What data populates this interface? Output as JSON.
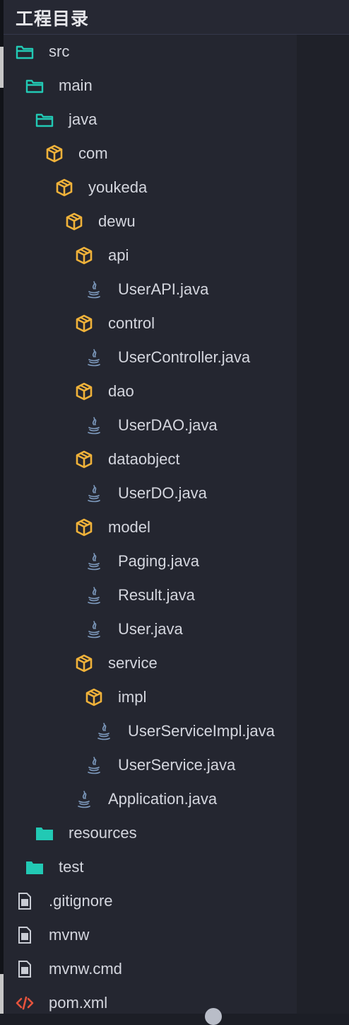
{
  "header": {
    "title": "工程目录"
  },
  "colors": {
    "folder": "#22c9b4",
    "package": "#f0b23a",
    "java": "#7f9cc0",
    "file": "#c9ccd4",
    "xml": "#e5533d"
  },
  "tree": [
    {
      "label": "src",
      "icon": "folder-open-icon",
      "depth": 0
    },
    {
      "label": "main",
      "icon": "folder-open-icon",
      "depth": 1
    },
    {
      "label": "java",
      "icon": "folder-open-icon",
      "depth": 2
    },
    {
      "label": "com",
      "icon": "package-icon",
      "depth": 3
    },
    {
      "label": "youkeda",
      "icon": "package-icon",
      "depth": 4
    },
    {
      "label": "dewu",
      "icon": "package-icon",
      "depth": 5
    },
    {
      "label": "api",
      "icon": "package-icon",
      "depth": 6
    },
    {
      "label": "UserAPI.java",
      "icon": "java-file-icon",
      "depth": 7
    },
    {
      "label": "control",
      "icon": "package-icon",
      "depth": 6
    },
    {
      "label": "UserController.java",
      "icon": "java-file-icon",
      "depth": 7
    },
    {
      "label": "dao",
      "icon": "package-icon",
      "depth": 6
    },
    {
      "label": "UserDAO.java",
      "icon": "java-file-icon",
      "depth": 7
    },
    {
      "label": "dataobject",
      "icon": "package-icon",
      "depth": 6
    },
    {
      "label": "UserDO.java",
      "icon": "java-file-icon",
      "depth": 7
    },
    {
      "label": "model",
      "icon": "package-icon",
      "depth": 6
    },
    {
      "label": "Paging.java",
      "icon": "java-file-icon",
      "depth": 7
    },
    {
      "label": "Result.java",
      "icon": "java-file-icon",
      "depth": 7
    },
    {
      "label": "User.java",
      "icon": "java-file-icon",
      "depth": 7
    },
    {
      "label": "service",
      "icon": "package-icon",
      "depth": 6
    },
    {
      "label": "impl",
      "icon": "package-icon",
      "depth": 7
    },
    {
      "label": "UserServiceImpl.java",
      "icon": "java-file-icon",
      "depth": 8
    },
    {
      "label": "UserService.java",
      "icon": "java-file-icon",
      "depth": 7
    },
    {
      "label": "Application.java",
      "icon": "java-file-icon",
      "depth": 6
    },
    {
      "label": "resources",
      "icon": "folder-closed-icon",
      "depth": 2
    },
    {
      "label": "test",
      "icon": "folder-closed-icon",
      "depth": 1
    },
    {
      "label": ".gitignore",
      "icon": "file-icon",
      "depth": 0
    },
    {
      "label": "mvnw",
      "icon": "file-icon",
      "depth": 0
    },
    {
      "label": "mvnw.cmd",
      "icon": "file-icon",
      "depth": 0
    },
    {
      "label": "pom.xml",
      "icon": "xml-file-icon",
      "depth": 0
    }
  ]
}
